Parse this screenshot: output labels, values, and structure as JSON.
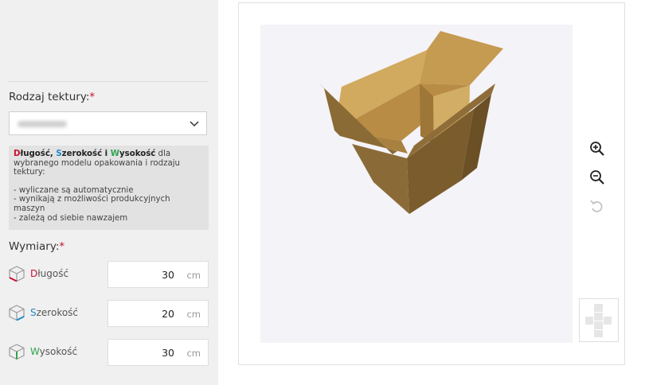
{
  "form": {
    "cardboard_type_label": "Rodzaj tektury:",
    "required_mark": "*",
    "cardboard_type_value": "",
    "info": {
      "d_letter": "D",
      "d_rest": "ługość",
      "sep1": ", ",
      "s_letter": "S",
      "s_rest": "zerokość",
      "sep2": " i ",
      "w_letter": "W",
      "w_rest": "ysokość",
      "text": " dla wybranego modelu opakowania i rodzaju tektury:",
      "bullet1": "- wyliczane są automatycznie",
      "bullet2": "- wynikają z możliwości produkcyjnych maszyn",
      "bullet3": "- zależą od siebie nawzajem"
    },
    "dimensions_label": "Wymiary:",
    "dimensions": {
      "length": {
        "first": "D",
        "rest": "ługość",
        "value": "30",
        "unit": "cm"
      },
      "width": {
        "first": "S",
        "rest": "zerokość",
        "value": "20",
        "unit": "cm"
      },
      "height": {
        "first": "W",
        "rest": "ysokość",
        "value": "30",
        "unit": "cm"
      }
    }
  },
  "viewer": {
    "icons": [
      "zoom-in-icon",
      "zoom-out-icon",
      "reset-view-icon",
      "box-net-icon"
    ]
  },
  "colors": {
    "length_accent": "#c8102e",
    "width_accent": "#1e88c8",
    "height_accent": "#2ea44f",
    "cardboard": "#c9a25c"
  }
}
